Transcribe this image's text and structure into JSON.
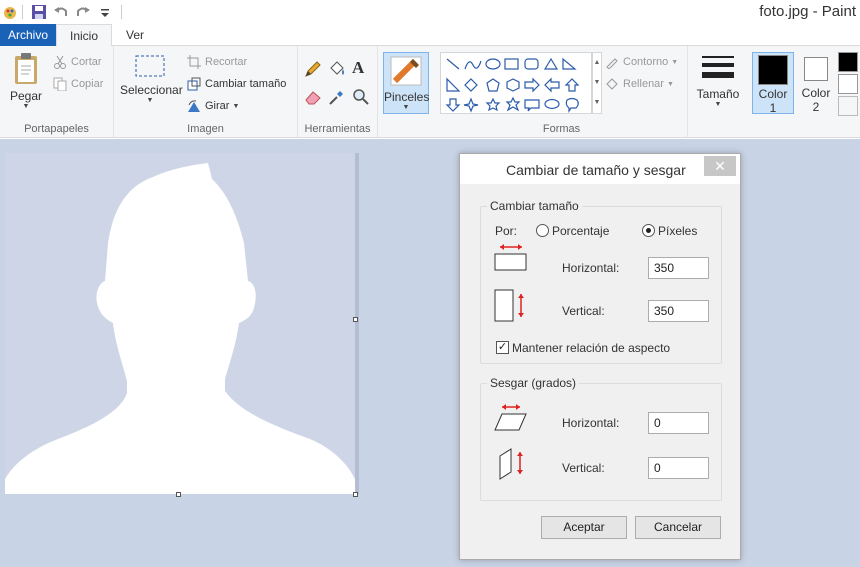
{
  "window": {
    "title": "foto.jpg - Paint"
  },
  "qat": {
    "icons": [
      "paint-app-icon",
      "save-icon",
      "undo-icon",
      "redo-icon",
      "customize-icon"
    ]
  },
  "tabs": [
    {
      "label": "Archivo",
      "active": false
    },
    {
      "label": "Inicio",
      "active": true
    },
    {
      "label": "Ver",
      "active": false
    }
  ],
  "ribbon": {
    "portapapeles": {
      "label": "Portapapeles",
      "pegar": "Pegar",
      "cortar": "Cortar",
      "copiar": "Copiar"
    },
    "imagen": {
      "label": "Imagen",
      "seleccionar": "Seleccionar",
      "recortar": "Recortar",
      "cambiar_tamano": "Cambiar tamaño",
      "girar": "Girar"
    },
    "herramientas": {
      "label": "Herramientas",
      "icons": [
        "pencil-icon",
        "fill-icon",
        "text-icon",
        "eraser-icon",
        "color-picker-icon",
        "magnifier-icon"
      ]
    },
    "pinceles": {
      "label": "Pinceles"
    },
    "formas": {
      "label": "Formas",
      "contorno": "Contorno",
      "rellenar": "Rellenar"
    },
    "tamano": {
      "label": "Tamaño"
    },
    "color1": {
      "label": "Color",
      "sub": "1",
      "value": "#000000"
    },
    "color2": {
      "label": "Color",
      "sub": "2",
      "value": "#ffffff"
    }
  },
  "colors": {
    "accent": "#1a62b8",
    "workspace": "#c8d3e5",
    "canvas_bg": "#cdd5e6"
  },
  "dialog": {
    "title": "Cambiar de tamaño y sesgar",
    "close": "✕",
    "resize": {
      "legend": "Cambiar tamaño",
      "por": "Por:",
      "porcentaje": "Porcentaje",
      "pixeles": "Píxeles",
      "selected": "pixeles",
      "horizontal_label": "Horizontal:",
      "horizontal_value": "350",
      "vertical_label": "Vertical:",
      "vertical_value": "350",
      "aspect_label": "Mantener relación de aspecto",
      "aspect_checked": true
    },
    "skew": {
      "legend": "Sesgar (grados)",
      "horizontal_label": "Horizontal:",
      "horizontal_value": "0",
      "vertical_label": "Vertical:",
      "vertical_value": "0"
    },
    "ok": "Aceptar",
    "cancel": "Cancelar"
  }
}
